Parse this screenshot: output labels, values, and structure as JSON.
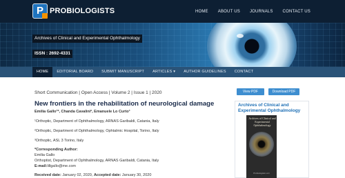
{
  "brand": {
    "mark": "P",
    "name": "PROBIOLOGISTS"
  },
  "top_nav": [
    "HOME",
    "ABOUT US",
    "JOURNALS",
    "CONTACT US"
  ],
  "banner": {
    "journal": "Archives of Clinical and Experimental Ophthalmology",
    "issn": "ISSN : 2692-4331"
  },
  "main_nav": [
    {
      "label": "HOME",
      "active": true
    },
    {
      "label": "EDITORIAL BOARD",
      "active": false
    },
    {
      "label": "SUBMIT MANUSCRIPT",
      "active": false
    },
    {
      "label": "ARTICLES ▾",
      "active": false
    },
    {
      "label": "AUTHOR GUIDELINES",
      "active": false
    },
    {
      "label": "CONTACT",
      "active": false
    }
  ],
  "article": {
    "meta": "Short Communication | Open Access | Volume 2 | Issue 1 | 2020",
    "title": "New frontiers in the rehabilitation of neurological damage",
    "authors": "Emilia Gallo¹*, Chanda Cavalini², Emanuele Lo Curto³",
    "affiliations": [
      "¹Orthoptic, Department of Ophthalmology, ARNAS Garibaldi, Catania, Italy",
      "²Orthoptic, Department of Ophthalmology, Ophtalmic Hospital, Torino, Italy",
      "³Orthoptic, ASL 3 Torino, Italy"
    ],
    "corresponding_heading": "*Corresponding Author:",
    "corresponding_name": "Emilia Gallo",
    "corresponding_dept": "Orthoptist, Department of Ophthalmology, ARNAS Garibaldi, Catania, Italy",
    "email_label": "E-mail:",
    "email": "lillgallo@me.com",
    "received_label": "Received date:",
    "received": "January 02, 2020",
    "accepted_label": "Accepted date:",
    "accepted": "January 30, 2020"
  },
  "sidebar": {
    "view_pdf": "View PDF",
    "download_pdf": "Download PDF",
    "journal_title": "Archives of Clinical and Experimental Ophthalmology",
    "cover_title": "Archives of Clinical and Experimental Ophthalmology",
    "cover_publisher": "Probiologists LLC"
  },
  "colors": {
    "topbar": "#0d1f33",
    "nav": "#2a5378",
    "accent": "#3e8ed0",
    "link": "#1e6fb5"
  }
}
